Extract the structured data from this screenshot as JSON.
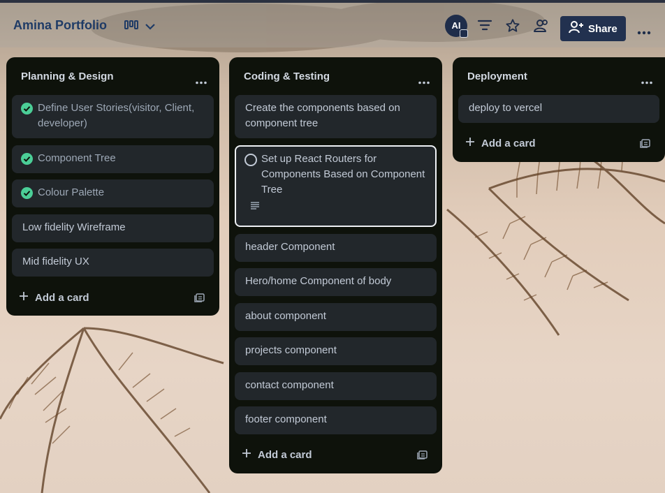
{
  "board": {
    "title": "Amina Portfolio"
  },
  "header": {
    "avatar_initials": "AI",
    "share_label": "Share",
    "icons": [
      "board-view-icon",
      "chevron-down-icon",
      "filter-icon",
      "star-icon",
      "workspace-visibility-icon",
      "add-member-icon",
      "more-horizontal-icon"
    ]
  },
  "lists": [
    {
      "title": "Planning & Design",
      "cards": [
        {
          "text": "Define User Stories(visitor, Client, developer)",
          "complete": true
        },
        {
          "text": "Component Tree",
          "complete": true
        },
        {
          "text": "Colour Palette",
          "complete": true
        },
        {
          "text": "Low fidelity Wireframe",
          "complete": false
        },
        {
          "text": "Mid fidelity UX",
          "complete": false
        }
      ],
      "add_label": "Add a card"
    },
    {
      "title": "Coding & Testing",
      "cards": [
        {
          "text": "Create the components based on component tree"
        },
        {
          "text": "Set up React Routers for Components Based on Component Tree",
          "focused": true,
          "has_description": true
        },
        {
          "text": "header Component"
        },
        {
          "text": "Hero/home Component of body"
        },
        {
          "text": "about component"
        },
        {
          "text": "projects component"
        },
        {
          "text": "contact component"
        },
        {
          "text": "footer component"
        }
      ],
      "add_label": "Add a card"
    },
    {
      "title": "Deployment",
      "cards": [
        {
          "text": "deploy to vercel"
        }
      ],
      "add_label": "Add a card"
    }
  ],
  "colors": {
    "list_bg": "#0e120b",
    "card_bg": "#22272b",
    "complete_green": "#4bce97",
    "share_button": "#22314f",
    "title_blue": "#1f3b66"
  }
}
